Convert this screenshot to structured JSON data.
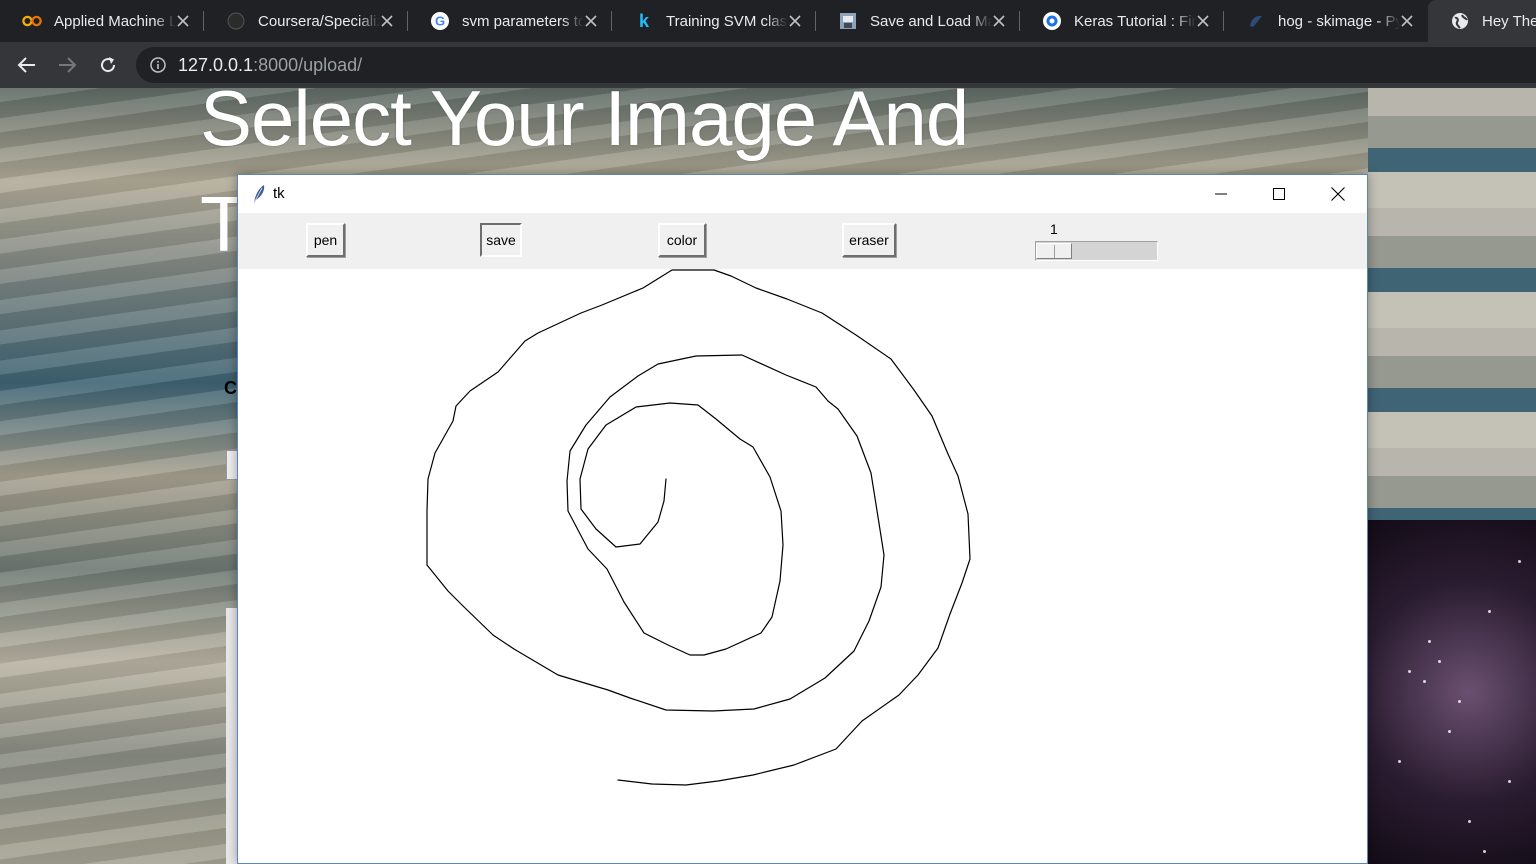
{
  "browser": {
    "tabs": [
      {
        "title": "Applied Machine Learning",
        "icon": "colab-icon",
        "active": false
      },
      {
        "title": "Coursera/Specializations",
        "icon": "github-icon",
        "active": false
      },
      {
        "title": "svm parameters to tune",
        "icon": "google-icon",
        "active": false
      },
      {
        "title": "Training SVM classifier",
        "icon": "kaggle-icon",
        "active": false
      },
      {
        "title": "Save and Load Machine",
        "icon": "page-icon",
        "active": false
      },
      {
        "title": "Keras Tutorial : Fine-tuning",
        "icon": "globe-blue-icon",
        "active": false
      },
      {
        "title": "hog - skimage - Python",
        "icon": "skimage-icon",
        "active": false
      },
      {
        "title": "Hey There",
        "icon": "globe-icon",
        "active": true
      }
    ],
    "address": {
      "host": "127.0.0.1",
      "path": ":8000/upload/"
    }
  },
  "page": {
    "heading": "Select Your Image And",
    "heading_line2_start": "T",
    "fragment": "C"
  },
  "tk": {
    "title": "tk",
    "buttons": {
      "pen": "pen",
      "save": "save",
      "color": "color",
      "eraser": "eraser"
    },
    "pressed_button": "save",
    "scale": {
      "value": 1,
      "label": "1"
    },
    "stroke_color": "#000000"
  },
  "colors": {
    "chrome_dark": "#202124",
    "chrome_toolbar": "#35363a",
    "tk_bg": "#f0f0f0",
    "tk_border": "#5a86b8"
  }
}
